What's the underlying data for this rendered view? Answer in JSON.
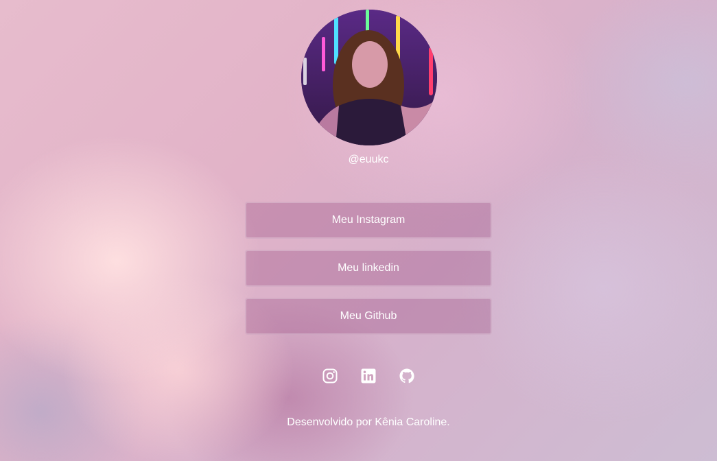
{
  "profile": {
    "handle": "@euukc"
  },
  "links": [
    {
      "label": "Meu Instagram"
    },
    {
      "label": "Meu linkedin"
    },
    {
      "label": "Meu Github"
    }
  ],
  "social_icons": [
    {
      "icon": "instagram-icon"
    },
    {
      "icon": "linkedin-icon"
    },
    {
      "icon": "github-icon"
    }
  ],
  "footer": {
    "text": "Desenvolvido por Kênia Caroline."
  },
  "colors": {
    "text": "#ffffff",
    "button_bg": "rgba(160,90,140,0.38)"
  }
}
